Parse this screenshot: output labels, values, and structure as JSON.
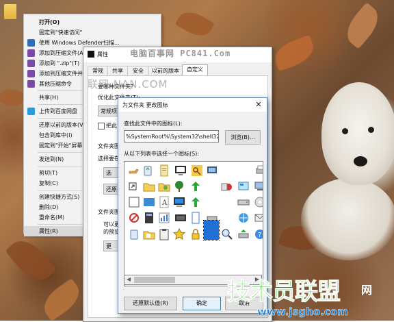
{
  "window_props": {
    "title": "属性",
    "tabs": [
      {
        "label": "常规"
      },
      {
        "label": "共享"
      },
      {
        "label": "安全"
      },
      {
        "label": "以前的版本"
      },
      {
        "label": "自定义"
      }
    ],
    "active_tab": "自定义",
    "body_fragments": {
      "line1": "要哪种文件夹?",
      "line2": "优化此文件夹(T):",
      "select_value": "常规项目",
      "checkbox": "把此",
      "section2": "文件夹图",
      "section2_sub": "选择要在",
      "btn_select": "选",
      "btn_restore": "还原",
      "section3": "文件夹图",
      "section3_sub": "可以更改",
      "section3_sub2": "的预览。",
      "btn_change": "更"
    }
  },
  "watermarks": {
    "top": "电脑百事网 PC841.Com",
    "mid": "联网  NAN.COM"
  },
  "context_menu": {
    "items": [
      {
        "label": "打开(O)",
        "bold": true,
        "icon": "none"
      },
      {
        "label": "固定到\"快速访问\"",
        "icon": "none"
      },
      {
        "label": "使用 Windows Defender扫描...",
        "icon": "defender-icon"
      },
      {
        "label": "添加到压缩文件(A)...",
        "icon": "winrar-icon"
      },
      {
        "label": "添加到 \".zip\"(T)",
        "icon": "winrar-icon"
      },
      {
        "label": "添加到压缩文件并...",
        "icon": "winrar-icon"
      },
      {
        "label": "其他压缩命令",
        "icon": "winrar-icon",
        "submenu": true
      },
      {
        "sep": true
      },
      {
        "label": "共享(H)",
        "submenu": true,
        "icon": "none"
      },
      {
        "sep": true
      },
      {
        "label": "上传到百度网盘",
        "icon": "baidu-cloud-icon"
      },
      {
        "sep": true
      },
      {
        "label": "还原以前的版本(V)",
        "icon": "none"
      },
      {
        "label": "包含到库中(I)",
        "submenu": true,
        "icon": "none"
      },
      {
        "label": "固定到\"开始\"屏幕(P)",
        "icon": "none"
      },
      {
        "sep": true
      },
      {
        "label": "发送到(N)",
        "submenu": true,
        "icon": "none"
      },
      {
        "sep": true
      },
      {
        "label": "剪切(T)",
        "icon": "none"
      },
      {
        "label": "复制(C)",
        "icon": "none"
      },
      {
        "sep": true
      },
      {
        "label": "创建快捷方式(S)",
        "icon": "none"
      },
      {
        "label": "删除(D)",
        "icon": "none"
      },
      {
        "label": "重命名(M)",
        "icon": "none"
      },
      {
        "sep": true
      },
      {
        "label": "属性(R)",
        "icon": "none",
        "highlighted": true
      }
    ]
  },
  "change_icon_dialog": {
    "title": "为文件夹 更改图标",
    "label_path": "查找此文件中的图标(L):",
    "path_value": "%SystemRoot%\\System32\\shell32.dll",
    "browse_label": "浏览(B)...",
    "label_list": "从以下列表中选择一个图标(S):",
    "restore_label": "还原默认值(R)",
    "ok_label": "确定",
    "cancel_label": "取消",
    "close_symbol": "✕",
    "scroll_left": "◀",
    "scroll_right": "▶"
  },
  "logo": {
    "main": "技术员联盟",
    "net": "网",
    "url": "www.jsgho.com"
  },
  "colors": {
    "accent": "#3c7fb1",
    "logo_green": "#3fcf2f",
    "logo_blue": "#1c7fd1"
  }
}
